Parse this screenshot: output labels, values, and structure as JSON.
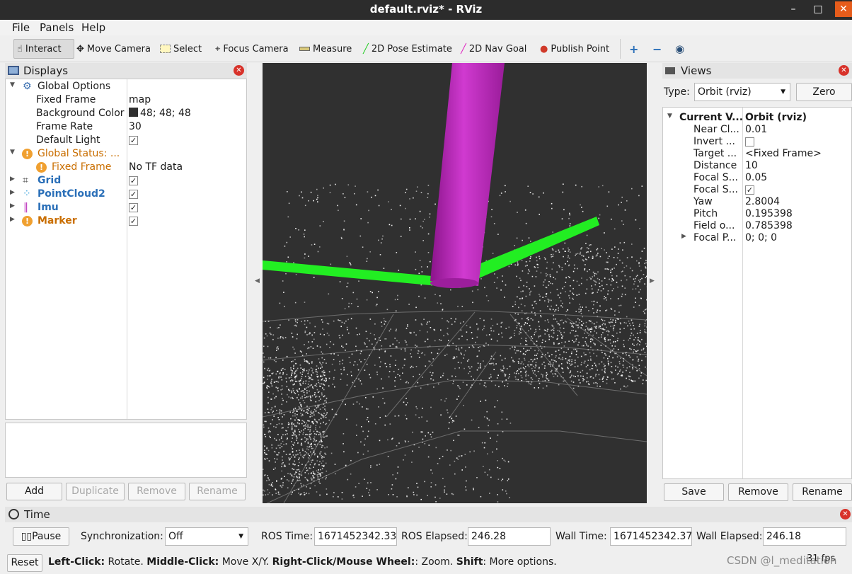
{
  "window": {
    "title": "default.rviz* - RViz",
    "min": "–",
    "max": "□",
    "close": "✕"
  },
  "menubar": {
    "file": "File",
    "panels": "Panels",
    "help": "Help"
  },
  "toolbar": {
    "interact": "Interact",
    "move_camera": "Move Camera",
    "select": "Select",
    "focus_camera": "Focus Camera",
    "measure": "Measure",
    "pose_estimate": "2D Pose Estimate",
    "nav_goal": "2D Nav Goal",
    "publish_point": "Publish Point",
    "colors": {
      "pose_estimate": "#22cc22",
      "nav_goal": "#e020c0",
      "publish_point": "#d03a2a"
    }
  },
  "displays": {
    "title": "Displays",
    "global_options": {
      "label": "Global Options",
      "fixed_frame": {
        "key": "Fixed Frame",
        "value": "map"
      },
      "background_color": {
        "key": "Background Color",
        "value": "48; 48; 48"
      },
      "frame_rate": {
        "key": "Frame Rate",
        "value": "30"
      },
      "default_light": {
        "key": "Default Light",
        "checked": "✓"
      }
    },
    "global_status": {
      "label": "Global Status: ...",
      "fixed_frame": {
        "key": "Fixed Frame",
        "value": "No TF data"
      }
    },
    "items": [
      {
        "label": "Grid",
        "checked": "✓"
      },
      {
        "label": "PointCloud2",
        "checked": "✓"
      },
      {
        "label": "Imu",
        "checked": "✓"
      },
      {
        "label": "Marker",
        "checked": "✓"
      }
    ],
    "buttons": {
      "add": "Add",
      "duplicate": "Duplicate",
      "remove": "Remove",
      "rename": "Rename"
    }
  },
  "views": {
    "title": "Views",
    "type_label": "Type:",
    "type_value": "Orbit (rviz)",
    "zero": "Zero",
    "current_view": {
      "key": "Current V...",
      "value": "Orbit (rviz)"
    },
    "props": [
      {
        "key": "Near Cl...",
        "value": "0.01"
      },
      {
        "key": "Invert ...",
        "value": ""
      },
      {
        "key": "Target ...",
        "value": "<Fixed Frame>"
      },
      {
        "key": "Distance",
        "value": "10"
      },
      {
        "key": "Focal S...",
        "value": "0.05"
      },
      {
        "key": "Focal S...",
        "value": "✓"
      },
      {
        "key": "Yaw",
        "value": "2.8004"
      },
      {
        "key": "Pitch",
        "value": "0.195398"
      },
      {
        "key": "Field o...",
        "value": "0.785398"
      },
      {
        "key": "Focal P...",
        "value": "0; 0; 0"
      }
    ],
    "buttons": {
      "save": "Save",
      "remove": "Remove",
      "rename": "Rename"
    }
  },
  "time": {
    "title": "Time",
    "pause": "Pause",
    "sync_label": "Synchronization:",
    "sync_value": "Off",
    "ros_time_label": "ROS Time:",
    "ros_time": "1671452342.33",
    "ros_elapsed_label": "ROS Elapsed:",
    "ros_elapsed": "246.28",
    "wall_time_label": "Wall Time:",
    "wall_time": "1671452342.37",
    "wall_elapsed_label": "Wall Elapsed:",
    "wall_elapsed": "246.18"
  },
  "status": {
    "reset": "Reset",
    "hint_1b": "Left-Click:",
    "hint_1": " Rotate. ",
    "hint_2b": "Middle-Click:",
    "hint_2": " Move X/Y. ",
    "hint_3b": "Right-Click/Mouse Wheel:",
    "hint_3": ": Zoom. ",
    "hint_4b": "Shift",
    "hint_4": ": More options.",
    "fps": "31 fps"
  },
  "watermark": "CSDN @l_meditation",
  "scene": {
    "background": "#303030",
    "cylinder_color": "#c832c8",
    "arrow_color": "#22ee22",
    "grid_color": "#a0a0a0",
    "points_color": "#ffffff"
  }
}
